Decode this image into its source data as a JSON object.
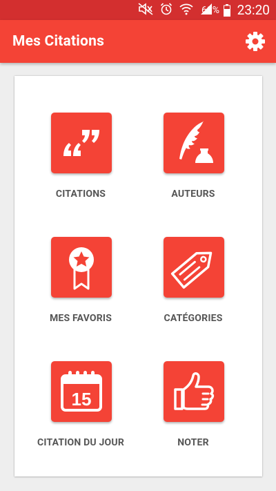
{
  "status_bar": {
    "battery_percent": "68%",
    "time": "23:20",
    "icons": [
      "mute-icon",
      "alarm-icon",
      "wifi-icon",
      "signal-icon",
      "battery-icon"
    ]
  },
  "app_bar": {
    "title": "Mes Citations",
    "settings_icon": "gear-icon"
  },
  "menu": {
    "items": [
      {
        "label": "CITATIONS",
        "icon": "quote-icon"
      },
      {
        "label": "AUTEURS",
        "icon": "quill-ink-icon"
      },
      {
        "label": "MES FAVORIS",
        "icon": "award-ribbon-icon"
      },
      {
        "label": "CATÉGORIES",
        "icon": "tag-icon"
      },
      {
        "label": "CITATION DU JOUR",
        "icon": "calendar-icon"
      },
      {
        "label": "NOTER",
        "icon": "thumbs-up-icon"
      }
    ]
  },
  "colors": {
    "primary": "#f44336",
    "primary_dark": "#d32f2f",
    "label": "#555555",
    "background": "#eeeeee",
    "card": "#ffffff"
  }
}
